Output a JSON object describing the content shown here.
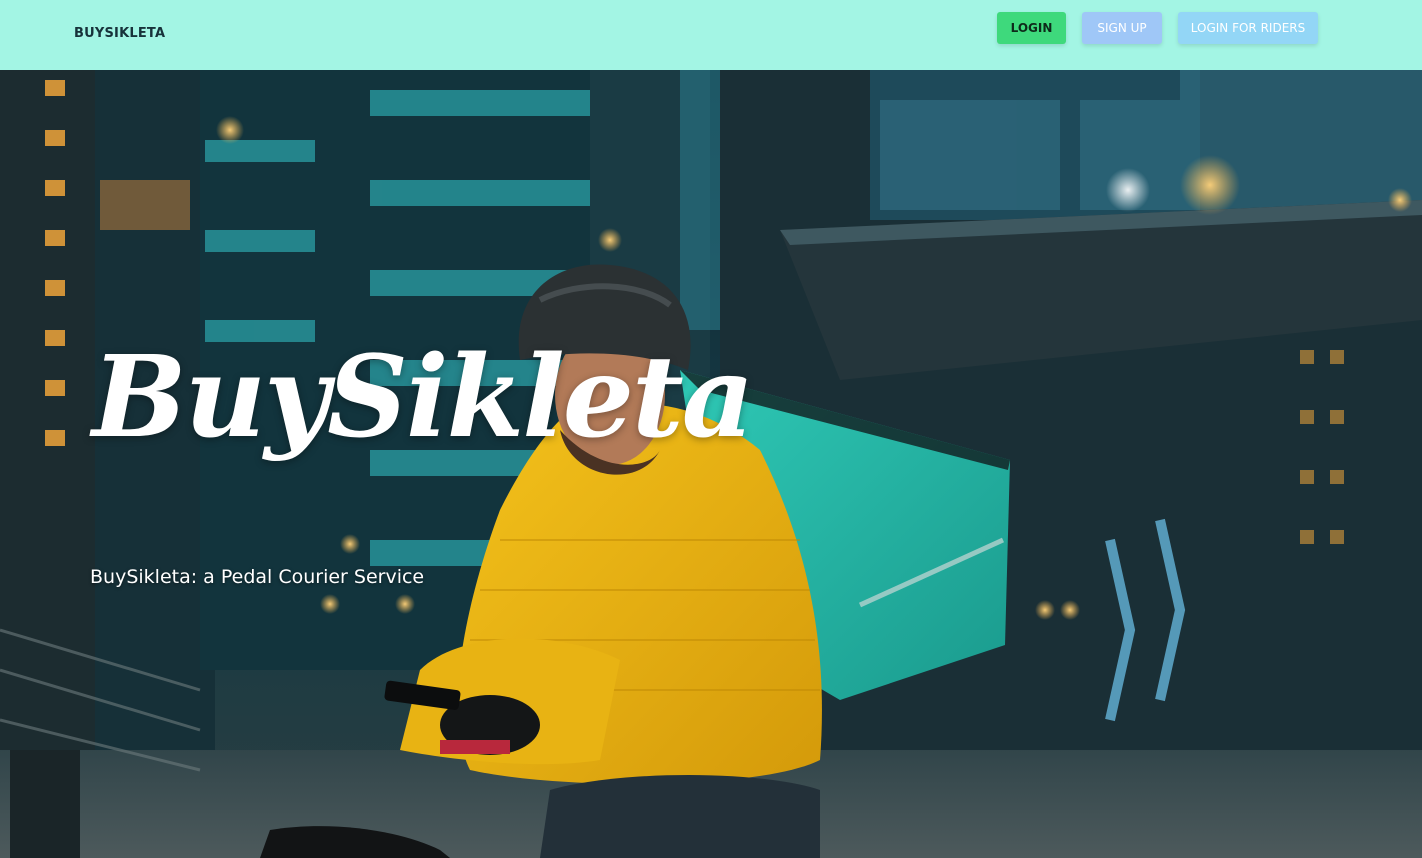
{
  "navbar": {
    "brand": "BUYSIKLETA",
    "login_label": "LOGIN",
    "signup_label": "SIGN UP",
    "riders_label": "LOGIN FOR RIDERS"
  },
  "hero": {
    "title": "BuySikleta",
    "subtitle": "BuySikleta: a Pedal Courier Service",
    "image": "courier-on-bicycle-city-photo"
  },
  "colors": {
    "navbar_bg": "#a3f5e4",
    "login_btn": "#3ed97c",
    "signup_btn": "#9fc7f7",
    "riders_btn": "#93d6f6",
    "text_light": "#ffffff"
  }
}
